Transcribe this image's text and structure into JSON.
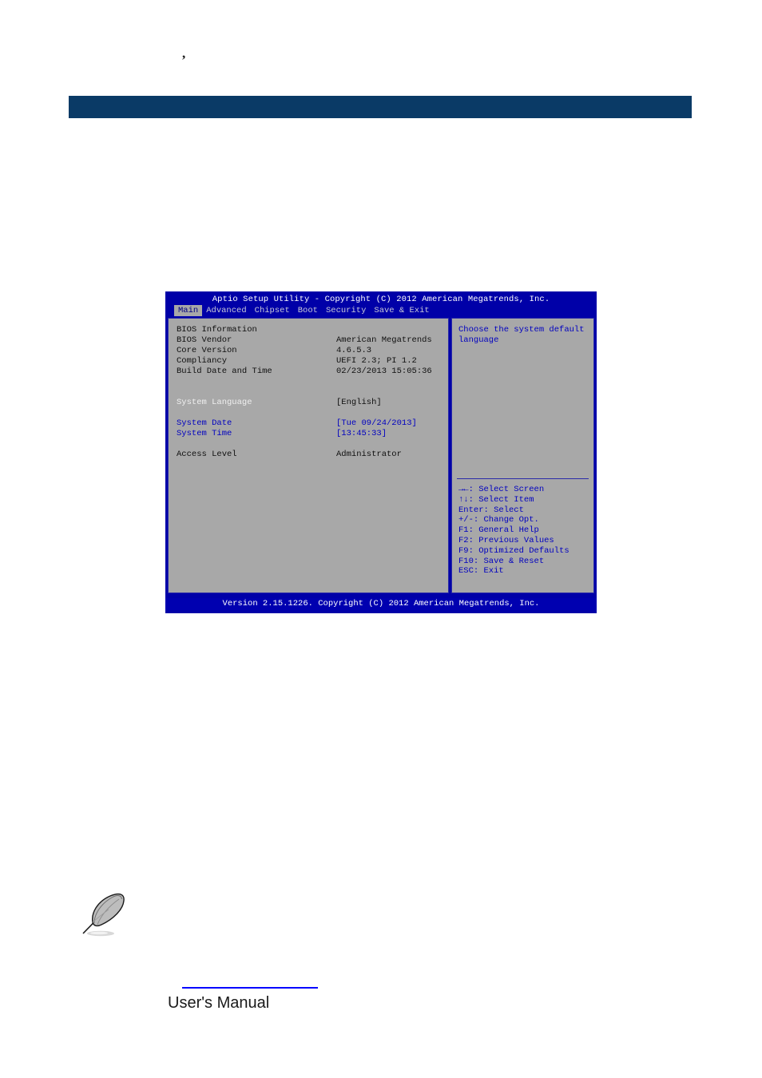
{
  "document": {
    "stray_mark": ",",
    "footer_title": "User's Manual",
    "note_icon_name": "quill-note-icon"
  },
  "bios": {
    "title": "Aptio Setup Utility - Copyright (C) 2012 American Megatrends, Inc.",
    "tabs": [
      {
        "label": "Main",
        "active": true
      },
      {
        "label": "Advanced",
        "active": false
      },
      {
        "label": "Chipset",
        "active": false
      },
      {
        "label": "Boot",
        "active": false
      },
      {
        "label": "Security",
        "active": false
      },
      {
        "label": "Save & Exit",
        "active": false
      }
    ],
    "main_panel": {
      "rows": [
        {
          "label": "BIOS Information",
          "value": "",
          "label_color": "black",
          "value_color": "black"
        },
        {
          "label": "BIOS Vendor",
          "value": "American Megatrends",
          "label_color": "black",
          "value_color": "black"
        },
        {
          "label": "Core Version",
          "value": "4.6.5.3",
          "label_color": "black",
          "value_color": "black"
        },
        {
          "label": "Compliancy",
          "value": "UEFI 2.3; PI 1.2",
          "label_color": "black",
          "value_color": "black"
        },
        {
          "label": "Build Date and Time",
          "value": "02/23/2013 15:05:36",
          "label_color": "black",
          "value_color": "black"
        },
        {
          "spacer": true
        },
        {
          "spacer": true
        },
        {
          "label": "System Language",
          "value": "[English]",
          "label_color": "white",
          "value_color": "black"
        },
        {
          "spacer": true
        },
        {
          "label": "System Date",
          "value": "[Tue 09/24/2013]",
          "label_color": "blue",
          "value_color": "blue"
        },
        {
          "label": "System Time",
          "value": "[13:45:33]",
          "label_color": "blue",
          "value_color": "blue"
        },
        {
          "spacer": true
        },
        {
          "label": "Access Level",
          "value": "Administrator",
          "label_color": "black",
          "value_color": "black"
        }
      ]
    },
    "help_panel": {
      "text": "Choose the system default language",
      "nav_keys": [
        "→←: Select Screen",
        "↑↓: Select Item",
        "Enter: Select",
        "+/-: Change Opt.",
        "F1: General Help",
        "F2: Previous Values",
        "F9: Optimized Defaults",
        "F10: Save & Reset",
        "ESC: Exit"
      ]
    },
    "footer": "Version 2.15.1226. Copyright (C) 2012 American Megatrends, Inc."
  },
  "colors": {
    "bios_blue": "#0000a8",
    "bios_panel_gray": "#a8a8a8",
    "bios_text_blue": "#0000c0",
    "header_navy": "#0a3a66",
    "rule_blue": "#0000ff"
  }
}
